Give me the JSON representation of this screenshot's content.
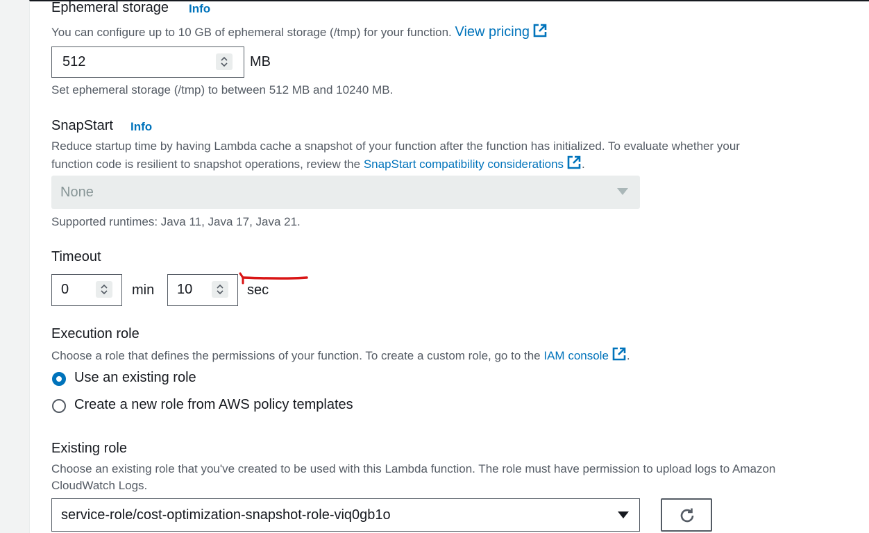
{
  "ephemeral": {
    "label": "Ephemeral storage",
    "info": "Info",
    "desc": "You can configure up to 10 GB of ephemeral storage (/tmp) for your function.",
    "link": "View pricing",
    "value": "512",
    "unit": "MB",
    "hint": "Set ephemeral storage (/tmp) to between 512 MB and 10240 MB."
  },
  "snapstart": {
    "label": "SnapStart",
    "info": "Info",
    "desc_line1": "Reduce startup time by having Lambda cache a snapshot of your function after the function has initialized. To evaluate whether your",
    "desc_line2_prefix": "function code is resilient to snapshot operations, review the",
    "link": "SnapStart compatibility considerations",
    "desc_suffix": ".",
    "select_value": "None",
    "hint": "Supported runtimes: Java 11, Java 17, Java 21."
  },
  "timeout": {
    "label": "Timeout",
    "min_value": "0",
    "min_unit": "min",
    "sec_value": "10",
    "sec_unit": "sec"
  },
  "execution_role": {
    "label": "Execution role",
    "desc_prefix": "Choose a role that defines the permissions of your function. To create a custom role, go to the",
    "link": "IAM console",
    "desc_suffix": ".",
    "option_existing": "Use an existing role",
    "option_new": "Create a new role from AWS policy templates",
    "selected": "existing"
  },
  "existing_role": {
    "label": "Existing role",
    "desc_line1": "Choose an existing role that you've created to be used with this Lambda function. The role must have permission to upload logs to Amazon",
    "desc_line2": "CloudWatch Logs.",
    "select_value": "service-role/cost-optimization-snapshot-role-viq0gb1o"
  },
  "colors": {
    "link": "#0073bb",
    "annotation": "#d91515",
    "text": "#16191f",
    "muted": "#545b64"
  },
  "icons": {
    "external": "external-link-icon",
    "refresh": "refresh-icon",
    "dropdown": "caret-down-icon",
    "spinner": "up-down-spinner-icon"
  }
}
